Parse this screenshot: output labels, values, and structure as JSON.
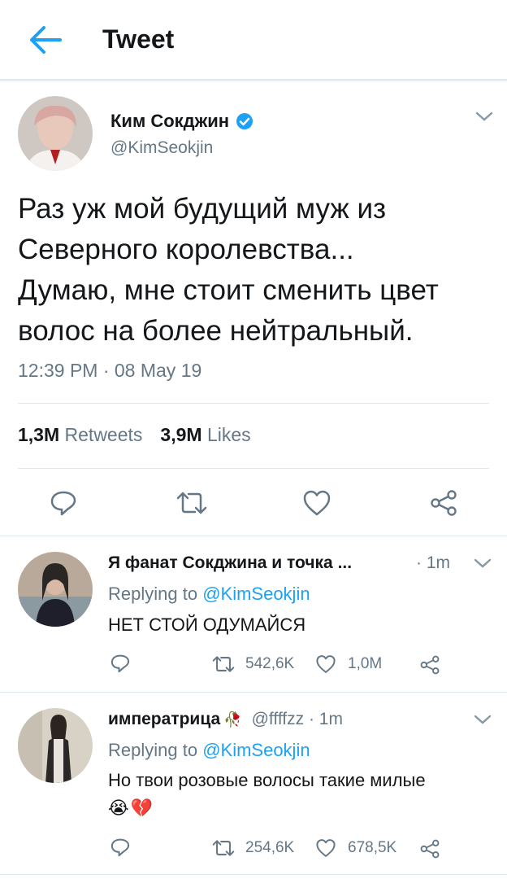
{
  "header": {
    "title": "Tweet",
    "back_icon": "arrow-left-icon"
  },
  "tweet": {
    "author_name": "Ким Сокджин",
    "verified_icon": "verified-badge-icon",
    "handle": "@KimSeokjin",
    "text_lines": [
      "Раз уж мой будущий муж из",
      "Северного королевства...",
      "Думаю, мне стоит сменить цвет",
      "волос на более нейтральный."
    ],
    "timestamp": "12:39 PM · 08 May 19",
    "retweets_count": "1,3M",
    "retweets_label": "Retweets",
    "likes_count": "3,9M",
    "likes_label": "Likes",
    "actions": [
      "reply-icon",
      "retweet-icon",
      "like-icon",
      "share-icon"
    ]
  },
  "replies": [
    {
      "name": "Я фанат Сокджина и точка ...",
      "time": "· 1m",
      "replying_prefix": "Replying to ",
      "replying_handle": "@KimSeokjin",
      "text": "НЕТ СТОЙ ОДУМАЙСЯ",
      "retweets": "542,6K",
      "likes": "1,0M"
    },
    {
      "name": "императрица",
      "name_emoji": "🥀",
      "handle_time": "@ffffzz · 1m",
      "replying_prefix": "Replying to ",
      "replying_handle": "@KimSeokjin",
      "text": "Но твои розовые волосы такие милые",
      "emojis": "😭💔",
      "retweets": "254,6K",
      "likes": "678,5K"
    }
  ],
  "colors": {
    "accent": "#1da1f2",
    "secondary": "#657786",
    "divider": "#e1e8ed",
    "text": "#14171a"
  }
}
